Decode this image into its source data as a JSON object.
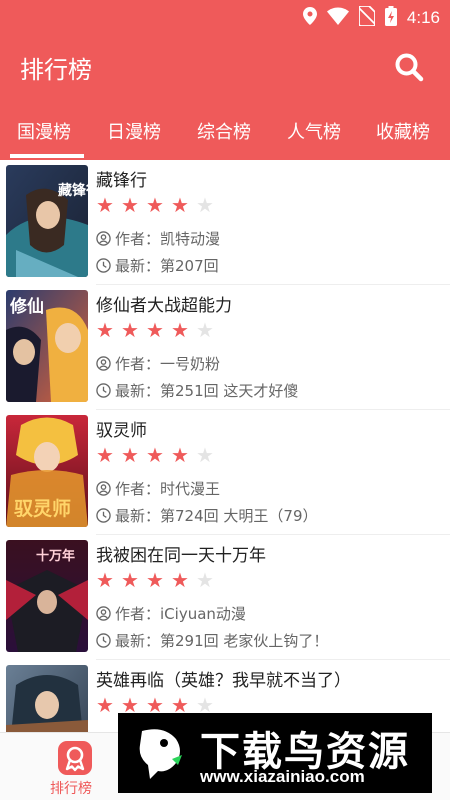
{
  "status_bar": {
    "time": "4:16",
    "icons": [
      "location-icon",
      "wifi-icon",
      "no-sim-icon",
      "battery-charging-icon"
    ]
  },
  "app_bar": {
    "title": "排行榜",
    "search_icon": "search-icon"
  },
  "tabs": [
    {
      "label": "国漫榜",
      "selected": true
    },
    {
      "label": "日漫榜",
      "selected": false
    },
    {
      "label": "综合榜",
      "selected": false
    },
    {
      "label": "人气榜",
      "selected": false
    },
    {
      "label": "收藏榜",
      "selected": false
    }
  ],
  "list": {
    "author_prefix": "作者：",
    "latest_prefix": "最新：",
    "items": [
      {
        "title": "藏锋行",
        "rating": 4,
        "max_rating": 5,
        "author": "凯特动漫",
        "latest": "第207回",
        "cover_text": "藏锋行"
      },
      {
        "title": "修仙者大战超能力",
        "rating": 4,
        "max_rating": 5,
        "author": "一号奶粉",
        "latest": "第251回 这天才好傻",
        "cover_text": "修仙"
      },
      {
        "title": "驭灵师",
        "rating": 4,
        "max_rating": 5,
        "author": "时代漫王",
        "latest": "第724回 大明王（79）",
        "cover_text": "驭灵师"
      },
      {
        "title": "我被困在同一天十万年",
        "rating": 4,
        "max_rating": 5,
        "author": "iCiyuan动漫",
        "latest": "第291回 老家伙上钩了！",
        "cover_text": "十万年"
      },
      {
        "title": "英雄再临（英雄？我早就不当了）",
        "rating": 4,
        "max_rating": 5,
        "author": "",
        "latest": "",
        "cover_text": ""
      }
    ]
  },
  "bottom_nav": {
    "items": [
      {
        "label": "排行榜",
        "icon": "ranking-icon",
        "active": true
      }
    ]
  },
  "watermark": {
    "title": "下载鸟资源",
    "url": "www.xiazainiao.com"
  },
  "colors": {
    "primary": "#ef5a5a",
    "star_on": "#ef5a5a",
    "star_off": "#e4e4e4",
    "text_primary": "#222222",
    "text_secondary": "#666666"
  }
}
